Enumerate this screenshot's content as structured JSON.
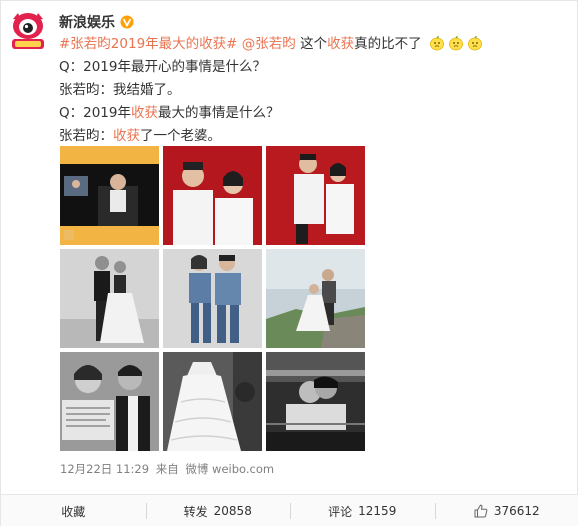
{
  "author": {
    "name": "新浪娱乐",
    "avatar_text": "新浪娱乐"
  },
  "post": {
    "line1": {
      "tag": "#张若昀2019年最大的收获#",
      "mention": "@张若昀",
      "text_a": " 这个",
      "hl": "收获",
      "text_b": "真的比不了"
    },
    "line2": "Q：2019年最开心的事情是什么？",
    "line3": "张若昀：我结婚了。",
    "line4": {
      "a": "Q：2019年",
      "hl": "收获",
      "b": "最大的事情是什么？"
    },
    "line5": {
      "a": "张若昀：",
      "hl": "收获",
      "b": "了一个老婆。"
    }
  },
  "emoji_name": "lemon-emoji",
  "images": [
    "video-frame",
    "couple-red-1",
    "couple-red-2",
    "couple-bw-dress",
    "couple-denim",
    "couple-outdoor",
    "couple-bw-newspaper",
    "bw-tulle-dress",
    "bw-car-kiss"
  ],
  "meta": {
    "date": "12月22日 11:29",
    "from_label": "来自",
    "source": "微博 weibo.com"
  },
  "actions": {
    "collect": "收藏",
    "repost_label": "转发",
    "repost_count": "20858",
    "comment_label": "评论",
    "comment_count": "12159",
    "like_count": "376612"
  },
  "colors": {
    "accent": "#eb7350",
    "verified": "#ffa00a"
  }
}
